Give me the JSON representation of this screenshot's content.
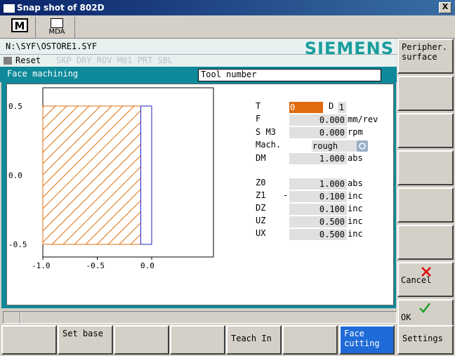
{
  "window": {
    "title": "Snap shot of 802D",
    "close_label": "X"
  },
  "modes": {
    "m_label": "M",
    "mda_label": "MDA"
  },
  "path": "N:\\SYF\\OSTORE1.SYF",
  "brand": "SIEMENS",
  "status": {
    "text": "Reset",
    "flags": "SKP DRY ROV M01 PRT SBL"
  },
  "panel": {
    "title": "Face machining",
    "tooltip": "Tool number"
  },
  "chart_data": {
    "type": "diagram",
    "x_ticks": [
      "-1.0",
      "-0.5",
      "0.0"
    ],
    "y_ticks": [
      "0.5",
      "0.0",
      "-0.5"
    ],
    "xlim": [
      -1.2,
      0.5
    ],
    "ylim": [
      -0.6,
      0.6
    ],
    "workpiece": {
      "x0": -1.0,
      "x1": -0.1,
      "y0": -0.5,
      "y1": 0.5
    },
    "finish_allowance": {
      "x0": -0.1,
      "x1": 0.0,
      "y0": -0.5,
      "y1": 0.5
    },
    "colors": {
      "hatch": "#e07010",
      "allowance": "#2020c0"
    }
  },
  "fields": {
    "T": {
      "label": "T",
      "value": "0"
    },
    "D": {
      "label": "D",
      "value": "1"
    },
    "F": {
      "label": "F",
      "value": "0.000",
      "unit": "mm/rev"
    },
    "S": {
      "label": "S M3",
      "value": "0.000",
      "unit": "rpm"
    },
    "Mach": {
      "label": "Mach.",
      "value": "rough"
    },
    "DM": {
      "label": "DM",
      "value": "1.000",
      "unit": "abs"
    },
    "Z0": {
      "label": "Z0",
      "value": "1.000",
      "unit": "abs"
    },
    "Z1": {
      "label": "Z1",
      "sign": "-",
      "value": "0.100",
      "unit": "inc"
    },
    "DZ": {
      "label": "DZ",
      "value": "0.100",
      "unit": "inc"
    },
    "UZ": {
      "label": "UZ",
      "value": "0.500",
      "unit": "inc"
    },
    "UX": {
      "label": "UX",
      "value": "0.500",
      "unit": "inc"
    }
  },
  "softkeys_right": {
    "sk1": "Peripher. surface",
    "cancel": "Cancel",
    "ok": "OK"
  },
  "softkeys_bottom": {
    "b2": "Set base",
    "b5": "Teach In",
    "b7": "Face cutting",
    "b8": "Settings"
  },
  "colors": {
    "accent": "#0e8a9a",
    "active_softkey": "#1f6bd8",
    "brand": "#1a9d9d",
    "tool_field": "#e06a10"
  }
}
